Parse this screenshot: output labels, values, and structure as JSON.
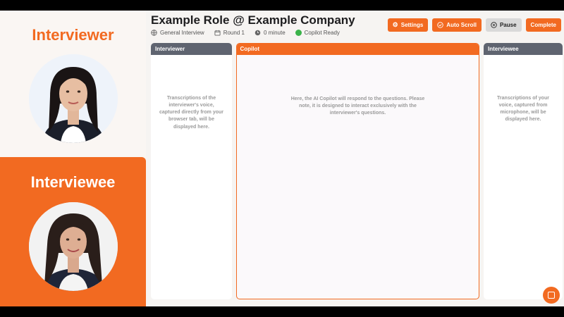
{
  "left": {
    "interviewer_title": "Interviewer",
    "interviewee_title": "Interviewee"
  },
  "header": {
    "job_title": "Example Role @ Example Company",
    "meta": [
      {
        "icon": "globe-icon",
        "text": "General Interview"
      },
      {
        "icon": "calendar-icon",
        "text": "Round 1"
      },
      {
        "icon": "clock-icon",
        "text": "0 minute"
      },
      {
        "icon": "status-dot-icon",
        "text": "Copilot Ready"
      }
    ]
  },
  "toolbar": {
    "settings_label": "Settings",
    "auto_scroll_label": "Auto Scroll",
    "pause_label": "Pause",
    "complete_label": "Complete"
  },
  "columns": {
    "interviewer": {
      "header": "Interviewer",
      "placeholder": "Transcriptions of the interviewer's voice, captured directly from your browser tab, will be displayed here."
    },
    "copilot": {
      "header": "Copilot",
      "placeholder": "Here, the AI Copilot will respond to the questions. Please note, it is designed to interact exclusively with the interviewer's questions."
    },
    "interviewee": {
      "header": "Interviewee",
      "placeholder": "Transcriptions of your voice, captured from microphone, will be displayed here."
    }
  },
  "colors": {
    "accent": "#f26a21",
    "panel_header": "#5f6470",
    "ready": "#3bb34a"
  }
}
